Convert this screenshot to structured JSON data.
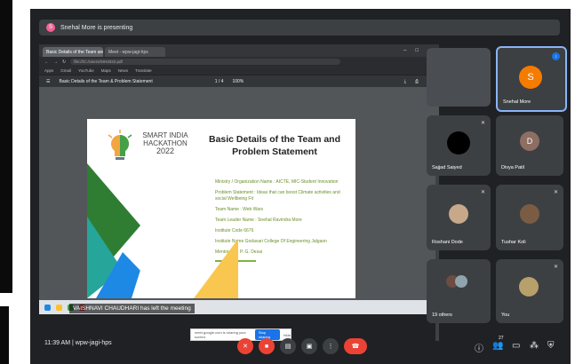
{
  "presenting_bar": {
    "avatar_letter": "S",
    "text": "Snehal More is presenting"
  },
  "browser": {
    "tabs": [
      "Basic Details of the Team and Pr",
      "Meet - wpw-jagi-hps"
    ],
    "address": "file:///C:/Users/SIH2022.pdf",
    "bookmarks": [
      "Apps",
      "Gmail",
      "YouTube",
      "Maps",
      "News",
      "Translate"
    ]
  },
  "pdf": {
    "toolbar_title": "Basic Details of the Team & Problem Statement",
    "page": "1 / 4",
    "zoom": "100%"
  },
  "slide": {
    "logo_lines": [
      "SMART INDIA",
      "HACKATHON",
      "2022"
    ],
    "title": "Basic Details of the Team and Problem Statement",
    "details": [
      "Ministry / Organization Name : AICTE, MIC-Student Innovation",
      "Problem Statement : Ideas that can boost Climate activities and social Wellbeing Fit",
      "Team Name : Web Wars",
      "Team Leader Name : Snehal Ravindra More",
      "Institute Code 6676",
      "Institute Name Godavari College Of Engineering Jalgaon",
      "Mentor : Mr. P. G. Desai"
    ]
  },
  "toast": {
    "text": "meet.google.com is sharing your screen.",
    "stop": "Stop sharing",
    "hide": "Hide"
  },
  "notification": "VAISHNAVI CHAUDHARI has left the meeting",
  "tiles": {
    "presenter": {
      "name": "Snehal More",
      "letter": "S",
      "color": "#f57c00"
    },
    "sajjad": {
      "name": "Sajjad Saiyed"
    },
    "divya": {
      "name": "Divya Patil",
      "letter": "D",
      "color": "#8d6e63"
    },
    "roshani": {
      "name": "Roshani Dode"
    },
    "tushar": {
      "name": "Tushar Koli"
    },
    "others": {
      "name": "19 others"
    },
    "you": {
      "name": "You"
    }
  },
  "meeting": {
    "time": "11:39 AM",
    "code": "wpw-jagi-hps",
    "participants_badge": "27"
  },
  "colors": {
    "background": "#202124",
    "tile": "#3c4043",
    "end_call": "#ea4335",
    "active_border": "#8ab4f8"
  }
}
